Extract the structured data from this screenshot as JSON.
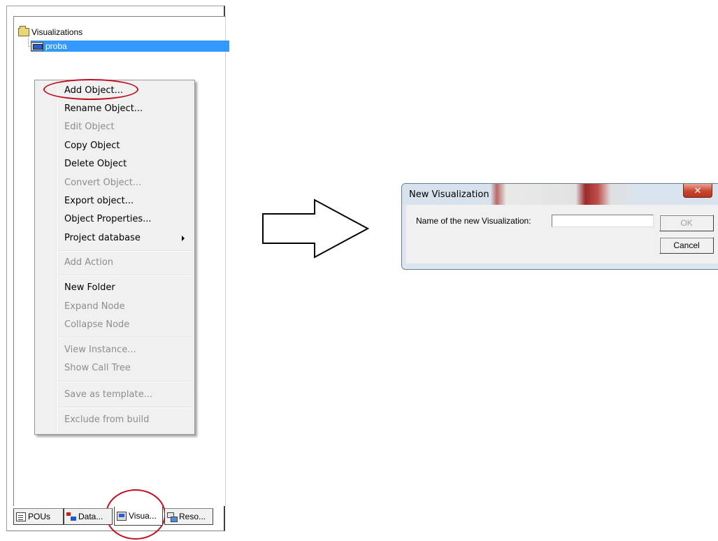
{
  "tree": {
    "root_label": "Visualizations",
    "child_label": "proba"
  },
  "context_menu": {
    "items": [
      {
        "label": "Add Object...",
        "enabled": true
      },
      {
        "label": "Rename Object...",
        "enabled": true
      },
      {
        "label": "Edit Object",
        "enabled": false
      },
      {
        "label": "Copy Object",
        "enabled": true
      },
      {
        "label": "Delete Object",
        "enabled": true
      },
      {
        "label": "Convert Object...",
        "enabled": false
      },
      {
        "label": "Export object...",
        "enabled": true
      },
      {
        "label": "Object Properties...",
        "enabled": true
      },
      {
        "label": "Project database",
        "enabled": true,
        "submenu": true
      },
      {
        "label": "Add Action",
        "enabled": false
      },
      {
        "label": "New Folder",
        "enabled": true
      },
      {
        "label": "Expand Node",
        "enabled": false
      },
      {
        "label": "Collapse Node",
        "enabled": false
      },
      {
        "label": "View Instance...",
        "enabled": false
      },
      {
        "label": "Show Call Tree",
        "enabled": false
      },
      {
        "label": "Save as template...",
        "enabled": false
      },
      {
        "label": "Exclude from build",
        "enabled": false
      }
    ]
  },
  "tabs": [
    {
      "label": "POUs",
      "icon": "pous-icon"
    },
    {
      "label": "Data...",
      "icon": "data-types-icon"
    },
    {
      "label": "Visua...",
      "icon": "visualization-icon",
      "active": true
    },
    {
      "label": "Reso...",
      "icon": "resources-icon"
    }
  ],
  "dialog": {
    "title": "New Visualization",
    "close_label": "✕",
    "field_label": "Name of the new Visualization:",
    "field_value": "",
    "ok_label": "OK",
    "cancel_label": "Cancel"
  },
  "annotation_color": "#c01020"
}
